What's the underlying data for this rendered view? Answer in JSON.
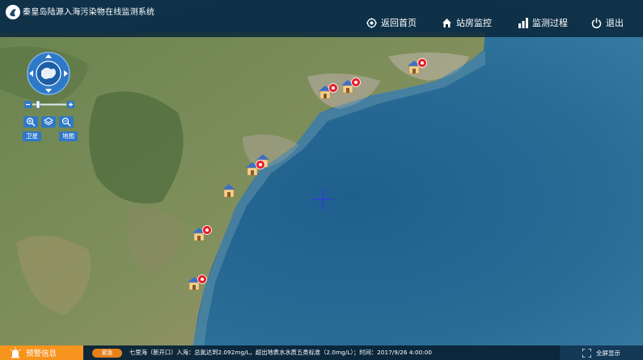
{
  "header": {
    "title": "秦皇岛陆源入海污染物在线监测系统",
    "nav": [
      {
        "label": "返回首页",
        "icon": "target-icon"
      },
      {
        "label": "站房监控",
        "icon": "house-icon"
      },
      {
        "label": "监测过程",
        "icon": "bar-chart-icon"
      },
      {
        "label": "退出",
        "icon": "power-icon"
      }
    ]
  },
  "map_controls": {
    "layers": {
      "satellite": "卫星",
      "map": "地图"
    }
  },
  "stations": [
    {
      "icon": "station-alarm-icon"
    },
    {
      "icon": "station-alarm-icon"
    },
    {
      "icon": "station-alarm-icon"
    },
    {
      "icon": "station-icon"
    },
    {
      "icon": "station-alarm-icon"
    },
    {
      "icon": "station-icon"
    },
    {
      "icon": "station-alarm-icon"
    },
    {
      "icon": "station-alarm-icon"
    },
    {
      "icon": "station-alarm-icon"
    }
  ],
  "footer": {
    "alert_tab_label": "预警信息",
    "badge": "紧急",
    "alert_text": "七里海（新开口）入海：总氮达到2.092mg/L，超出地表水水质五类标准（2.0mg/L）；时间：2017/9/26 4:00:00",
    "fullscreen_label": "全屏显示"
  },
  "colors": {
    "header_bg": "#0a283c",
    "accent_blue": "#2e78c8",
    "alert_orange": "#f7941d",
    "alarm_red": "#e8202a"
  }
}
